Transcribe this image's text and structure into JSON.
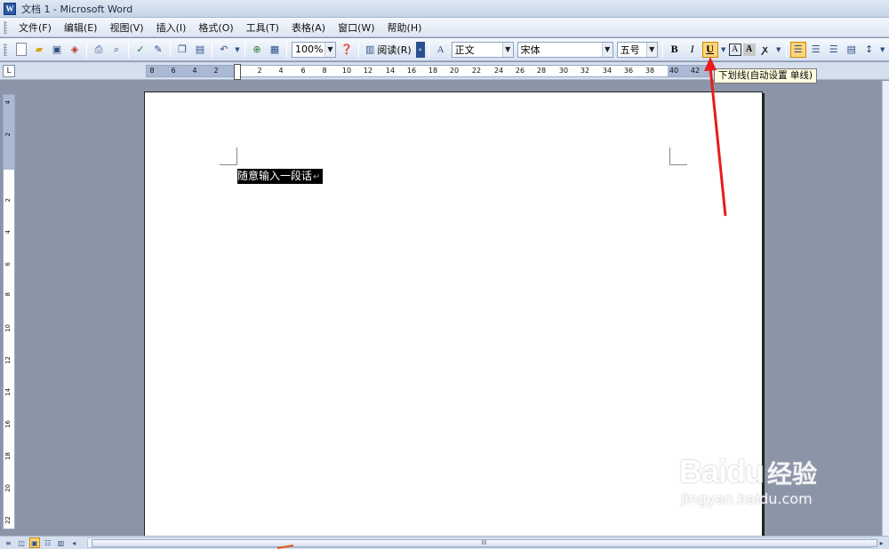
{
  "window": {
    "title": "文档 1 - Microsoft Word",
    "app_icon": "W"
  },
  "menubar": {
    "items": [
      "文件(F)",
      "编辑(E)",
      "视图(V)",
      "插入(I)",
      "格式(O)",
      "工具(T)",
      "表格(A)",
      "窗口(W)",
      "帮助(H)"
    ]
  },
  "toolbar": {
    "zoom": "100%",
    "read_label": "阅读(R)",
    "style_value": "正文",
    "font_value": "宋体",
    "size_value": "五号",
    "bold": "B",
    "italic": "I",
    "underline": "U",
    "char_border": "A",
    "char_shading": "A"
  },
  "tooltip": {
    "text": "下划线(自动设置 单线)"
  },
  "ruler": {
    "corner": "L",
    "h_labels": [
      "8",
      "6",
      "4",
      "2",
      "2",
      "4",
      "6",
      "8",
      "10",
      "12",
      "14",
      "16",
      "18",
      "20",
      "22",
      "24",
      "26",
      "28",
      "30",
      "32",
      "34",
      "36",
      "38",
      "40",
      "42"
    ],
    "v_labels": [
      "4",
      "2",
      "2",
      "4",
      "6",
      "8",
      "10",
      "12",
      "14",
      "16",
      "18",
      "20",
      "22"
    ]
  },
  "document": {
    "selected_text": "随意输入一段话",
    "paragraph_mark": "↵"
  },
  "statusbar": {
    "scroll_grip": "III"
  },
  "watermark": {
    "brand": "Bai",
    "brand_cn": "经验",
    "url": "jingyan.baidu.com"
  },
  "colors": {
    "annotation_arrow": "#e81c1c",
    "active_button": "#ffd57a",
    "selection": "#000000"
  }
}
